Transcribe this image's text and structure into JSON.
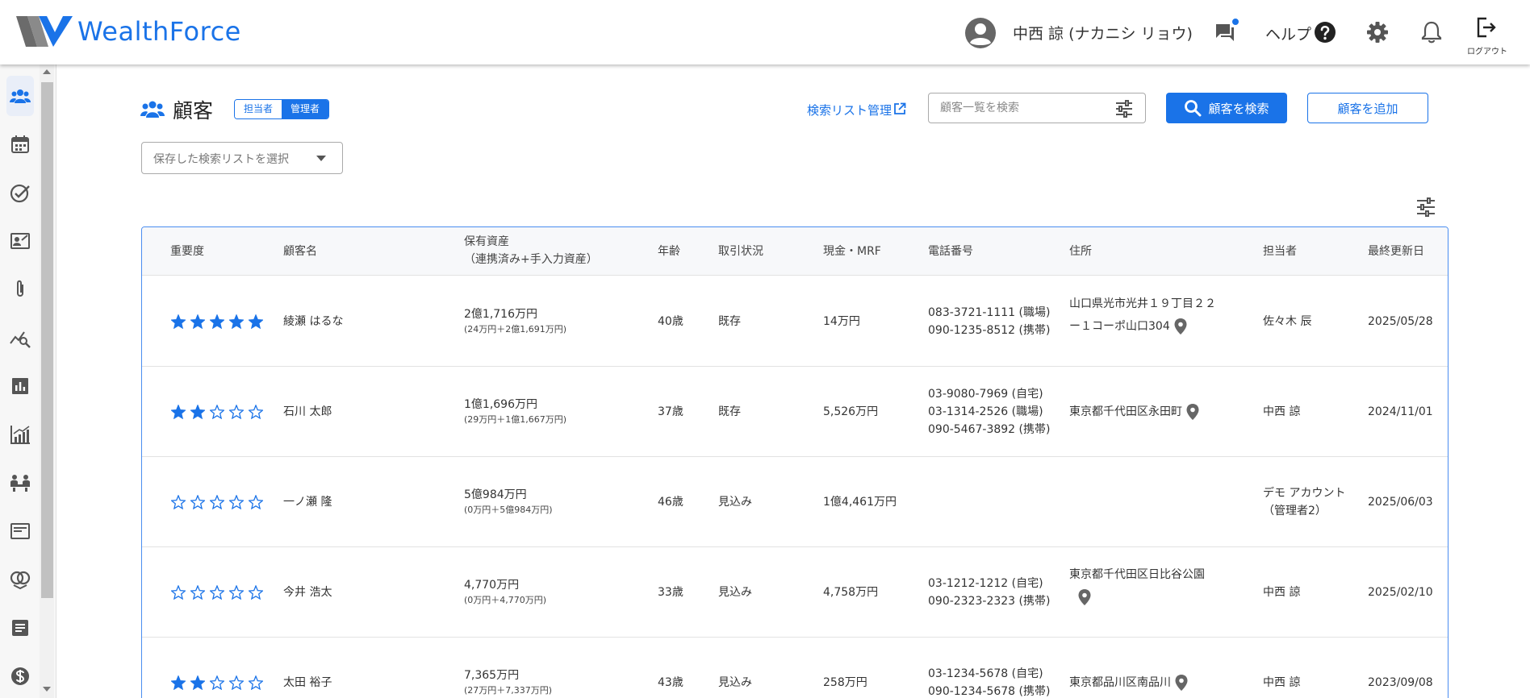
{
  "header": {
    "logo_text": "WealthForce",
    "user_name": "中西 諒 (ナカニシ リョウ)",
    "help_label": "ヘルプ",
    "logout_label": "ログアウト"
  },
  "page": {
    "title": "顧客",
    "role_toggle": [
      "担当者",
      "管理者"
    ],
    "role_selected": "管理者",
    "saved_list_link": "検索リスト管理",
    "search": {
      "placeholder": "顧客一覧を検索",
      "value": ""
    },
    "search_button": "顧客を検索",
    "add_button": "顧客を追加",
    "saved_select_placeholder": "保存した検索リストを選択"
  },
  "table": {
    "headers": {
      "importance": "重要度",
      "name": "顧客名",
      "assets_line1": "保有資産",
      "assets_line2": "（連携済み+手入力資産）",
      "age": "年齢",
      "status": "取引状況",
      "cash": "現金・MRF",
      "phone": "電話番号",
      "address": "住所",
      "owner": "担当者",
      "updated": "最終更新日"
    },
    "rows": [
      {
        "stars": 5,
        "name": "綾瀬 はるな",
        "assets": "2億1,716万円",
        "assets_detail": "(24万円＋2億1,691万円)",
        "age": "40歳",
        "status": "既存",
        "cash": "14万円",
        "phones": [
          "083-3721-1111 (職場)",
          "090-1235-8512 (携帯)"
        ],
        "address_lines": [
          "山口県光市光井１９丁目２２",
          "ー１コーポ山口304"
        ],
        "owner_lines": [
          "佐々木 辰"
        ],
        "updated": "2025/05/28"
      },
      {
        "stars": 2,
        "name": "石川 太郎",
        "assets": "1億1,696万円",
        "assets_detail": "(29万円＋1億1,667万円)",
        "age": "37歳",
        "status": "既存",
        "cash": "5,526万円",
        "phones": [
          "03-9080-7969 (自宅)",
          "03-1314-2526 (職場)",
          "090-5467-3892 (携帯)"
        ],
        "address_lines": [
          "東京都千代田区永田町"
        ],
        "owner_lines": [
          "中西 諒"
        ],
        "updated": "2024/11/01"
      },
      {
        "stars": 0,
        "name": "一ノ瀬 隆",
        "assets": "5億984万円",
        "assets_detail": "(0万円＋5億984万円)",
        "age": "46歳",
        "status": "見込み",
        "cash": "1億4,461万円",
        "phones": [],
        "address_lines": [],
        "owner_lines": [
          "デモ アカウント",
          "（管理者2）"
        ],
        "updated": "2025/06/03"
      },
      {
        "stars": 0,
        "name": "今井 浩太",
        "assets": "4,770万円",
        "assets_detail": "(0万円＋4,770万円)",
        "age": "33歳",
        "status": "見込み",
        "cash": "4,758万円",
        "phones": [
          "03-1212-1212 (自宅)",
          "090-2323-2323 (携帯)"
        ],
        "address_lines": [
          "東京都千代田区日比谷公園"
        ],
        "owner_lines": [
          "中西 諒"
        ],
        "updated": "2025/02/10"
      },
      {
        "stars": 2,
        "name": "太田 裕子",
        "assets": "7,365万円",
        "assets_detail": "(27万円＋7,337万円)",
        "age": "43歳",
        "status": "見込み",
        "cash": "258万円",
        "phones": [
          "03-1234-5678 (自宅)",
          "090-1234-5678 (携帯)"
        ],
        "address_lines": [
          "東京都品川区南品川"
        ],
        "owner_lines": [
          "中西 諒"
        ],
        "updated": "2023/09/08"
      }
    ]
  },
  "colors": {
    "accent": "#1a73e8",
    "icon_gray": "#555555"
  }
}
